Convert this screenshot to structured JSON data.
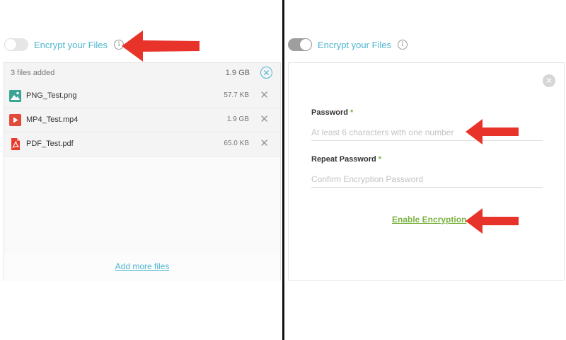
{
  "left_panel": {
    "toggle_label": "Encrypt your Files",
    "info_symbol": "i",
    "files_count": "3 files added",
    "total_size": "1.9 GB",
    "files": [
      {
        "name": "PNG_Test.png",
        "size": "57.7 KB",
        "icon": "image-file-icon",
        "color": "#3aa597"
      },
      {
        "name": "MP4_Test.mp4",
        "size": "1.9 GB",
        "icon": "video-file-icon",
        "color": "#e24b3b"
      },
      {
        "name": "PDF_Test.pdf",
        "size": "65.0 KB",
        "icon": "pdf-file-icon",
        "color": "#e63c2e"
      }
    ],
    "add_more_label": "Add more files"
  },
  "right_panel": {
    "toggle_label": "Encrypt your Files",
    "info_symbol": "i",
    "password_label": "Password",
    "password_placeholder": "At least 6 characters with one number",
    "repeat_label": "Repeat Password",
    "repeat_placeholder": "Confirm Encryption Password",
    "required_marker": "*",
    "enable_label": "Enable Encryption"
  },
  "colors": {
    "accent": "#4db6cf",
    "success": "#7cb342",
    "annotation_arrow": "#e8332b"
  },
  "icons": {
    "clear_all": "x-circle-icon",
    "remove": "close-icon",
    "close_form": "x-circle-icon",
    "info": "info-icon",
    "annotation": "red-arrow-icon"
  }
}
